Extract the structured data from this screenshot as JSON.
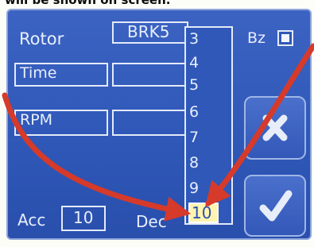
{
  "caption": {
    "text": "will be shown on screen."
  },
  "labels": {
    "rotor": "Rotor",
    "time": "Time",
    "rpm": "RPM",
    "acc": "Acc",
    "dec": "Dec",
    "bz": "Bz"
  },
  "fields": {
    "rotor_value": "BRK5",
    "acc_value": "10"
  },
  "dropdown": {
    "options": [
      "3",
      "4",
      "5",
      "6",
      "7",
      "8",
      "9",
      "10"
    ],
    "selected": "10"
  },
  "buttons": {
    "cancel_icon": "x-icon",
    "confirm_icon": "checkmark-icon"
  },
  "colors": {
    "panel": "#2f58b8",
    "arrow": "#d63a2a",
    "selected_option": "#fff4b0"
  }
}
